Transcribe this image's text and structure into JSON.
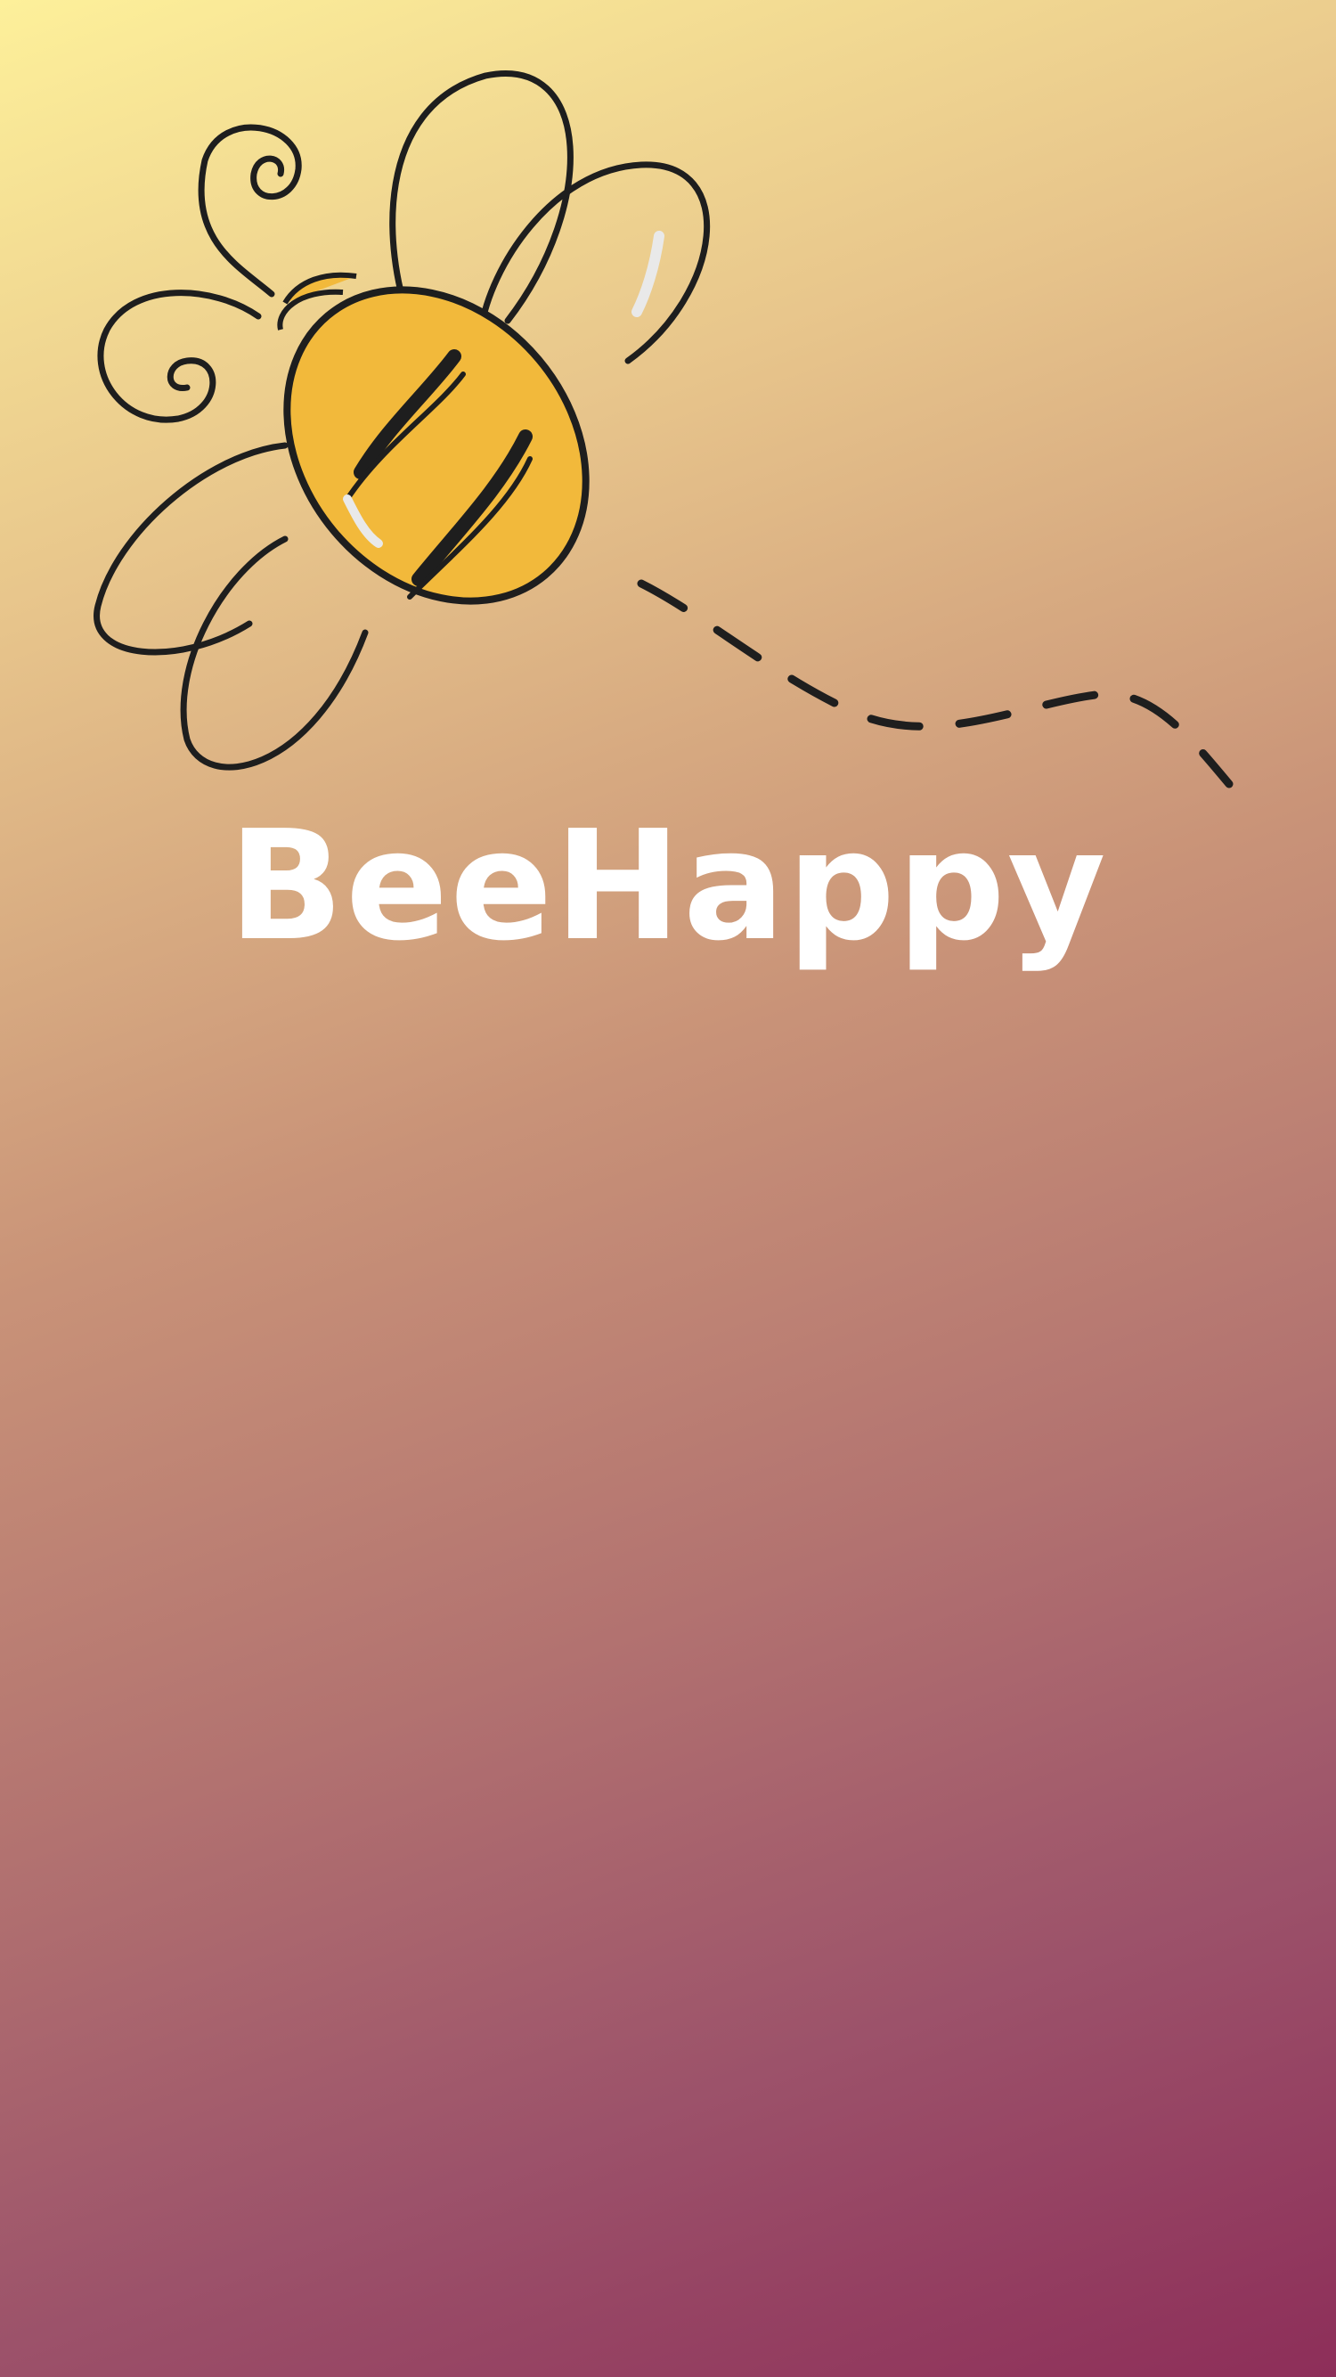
{
  "app": {
    "name": "BeeHappy"
  },
  "logo": {
    "icon": "bee-icon",
    "body_color": "#f2b93b",
    "line_color": "#1e1e1e",
    "highlight_color": "#e9e9e9"
  },
  "theme": {
    "gradient_start": "#fdf09a",
    "gradient_end": "#8d2e59",
    "title_color": "#ffffff"
  }
}
